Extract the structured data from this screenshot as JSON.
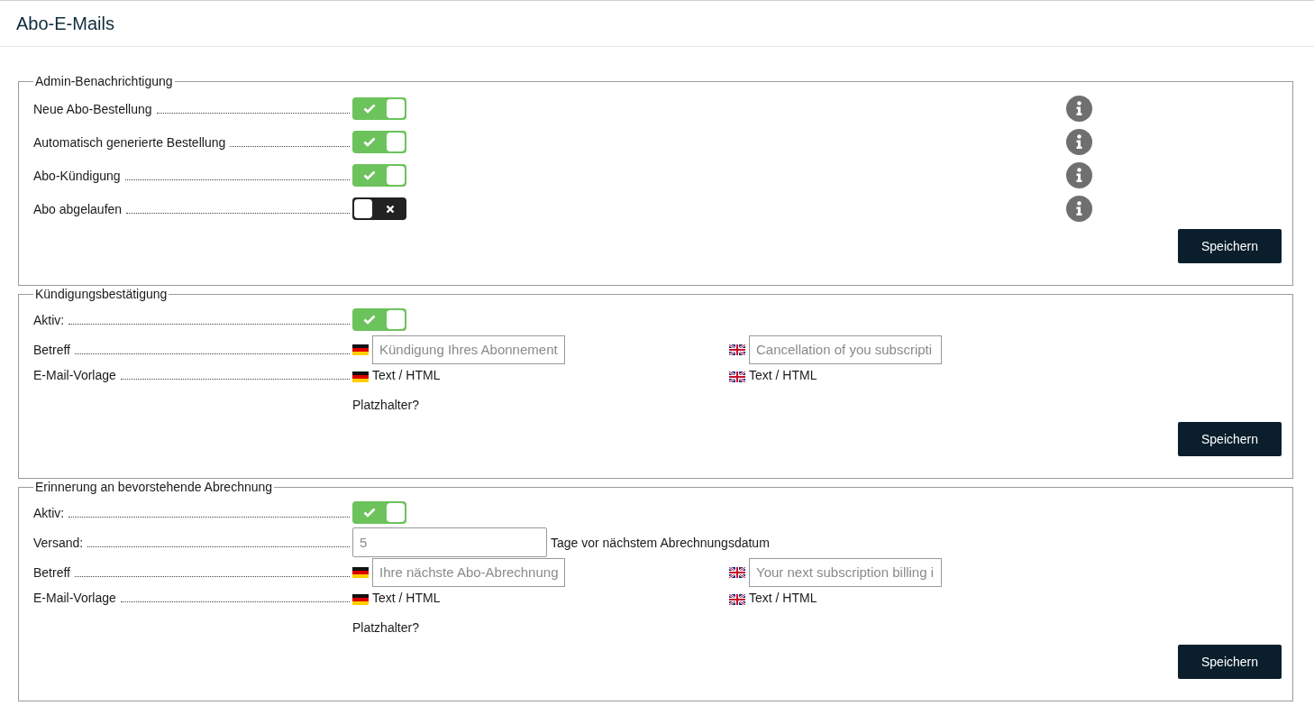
{
  "page_title": "Abo-E-Mails",
  "sections": [
    {
      "legend": "Admin-Benachrichtigung",
      "save_button": "Speichern",
      "rows": [
        {
          "kind": "toggle",
          "label": "Neue Abo-Bestellung",
          "on": true,
          "info": true
        },
        {
          "kind": "toggle",
          "label": "Automatisch generierte Bestellung",
          "on": true,
          "info": true
        },
        {
          "kind": "toggle",
          "label": "Abo-Kündigung",
          "on": true,
          "info": true
        },
        {
          "kind": "toggle",
          "label": "Abo abgelaufen",
          "on": false,
          "info": true
        }
      ]
    },
    {
      "legend": "Kündigungsbestätigung",
      "save_button": "Speichern",
      "rows": [
        {
          "kind": "toggle",
          "label": "Aktiv:",
          "on": true,
          "info": false
        },
        {
          "kind": "subject",
          "label": "Betreff",
          "items": [
            {
              "kind": "de",
              "placeholder": "Kündigung Ihres Abonnement"
            },
            {
              "kind": "en",
              "placeholder": "Cancellation of you subscripti"
            }
          ]
        },
        {
          "kind": "template",
          "label": "E-Mail-Vorlage",
          "items": [
            {
              "kind": "de",
              "text": "Text / HTML"
            },
            {
              "kind": "en",
              "text": "Text / HTML"
            }
          ]
        },
        {
          "kind": "link",
          "text": "Platzhalter?"
        }
      ]
    },
    {
      "legend": "Erinnerung an bevorstehende Abrechnung",
      "save_button": "Speichern",
      "rows": [
        {
          "kind": "toggle",
          "label": "Aktiv:",
          "on": true,
          "info": false
        },
        {
          "kind": "number",
          "label": "Versand:",
          "placeholder": "5",
          "suffix": "Tage vor nächstem Abrechnungsdatum"
        },
        {
          "kind": "subject",
          "label": "Betreff",
          "items": [
            {
              "kind": "de",
              "placeholder": "Ihre nächste Abo-Abrechnung"
            },
            {
              "kind": "en",
              "placeholder": "Your next subscription billing i"
            }
          ]
        },
        {
          "kind": "template",
          "label": "E-Mail-Vorlage",
          "items": [
            {
              "kind": "de",
              "text": "Text / HTML"
            },
            {
              "kind": "en",
              "text": "Text / HTML"
            }
          ]
        },
        {
          "kind": "link",
          "text": "Platzhalter?"
        }
      ]
    }
  ]
}
